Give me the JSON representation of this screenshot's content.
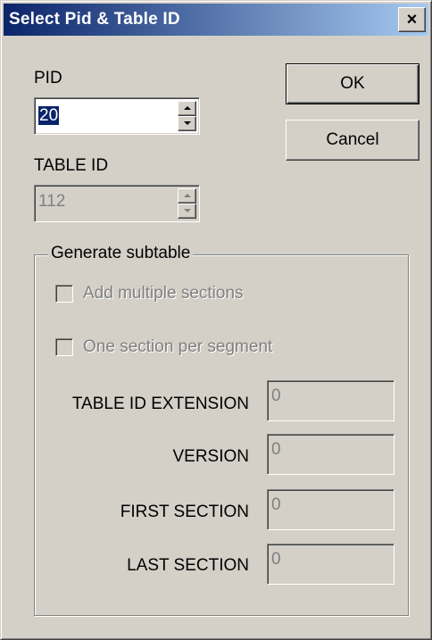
{
  "window": {
    "title": "Select Pid & Table ID",
    "close_glyph": "×"
  },
  "pid": {
    "label": "PID",
    "value": "20"
  },
  "table_id": {
    "label": "TABLE ID",
    "value": "112"
  },
  "buttons": {
    "ok_label": "OK",
    "cancel_label": "Cancel"
  },
  "subtable": {
    "group_label": "Generate subtable",
    "add_multiple_sections_label": "Add multiple sections",
    "add_multiple_sections_checked": false,
    "one_section_per_segment_label": "One section per segment",
    "one_section_per_segment_checked": false,
    "fields": [
      {
        "label": "TABLE ID EXTENSION",
        "value": "0"
      },
      {
        "label": "VERSION",
        "value": "0"
      },
      {
        "label": "FIRST SECTION",
        "value": "0"
      },
      {
        "label": "LAST SECTION",
        "value": "0"
      }
    ]
  },
  "icons": {
    "spin_up": "spin-up-icon",
    "spin_down": "spin-down-icon",
    "close": "close-icon"
  }
}
